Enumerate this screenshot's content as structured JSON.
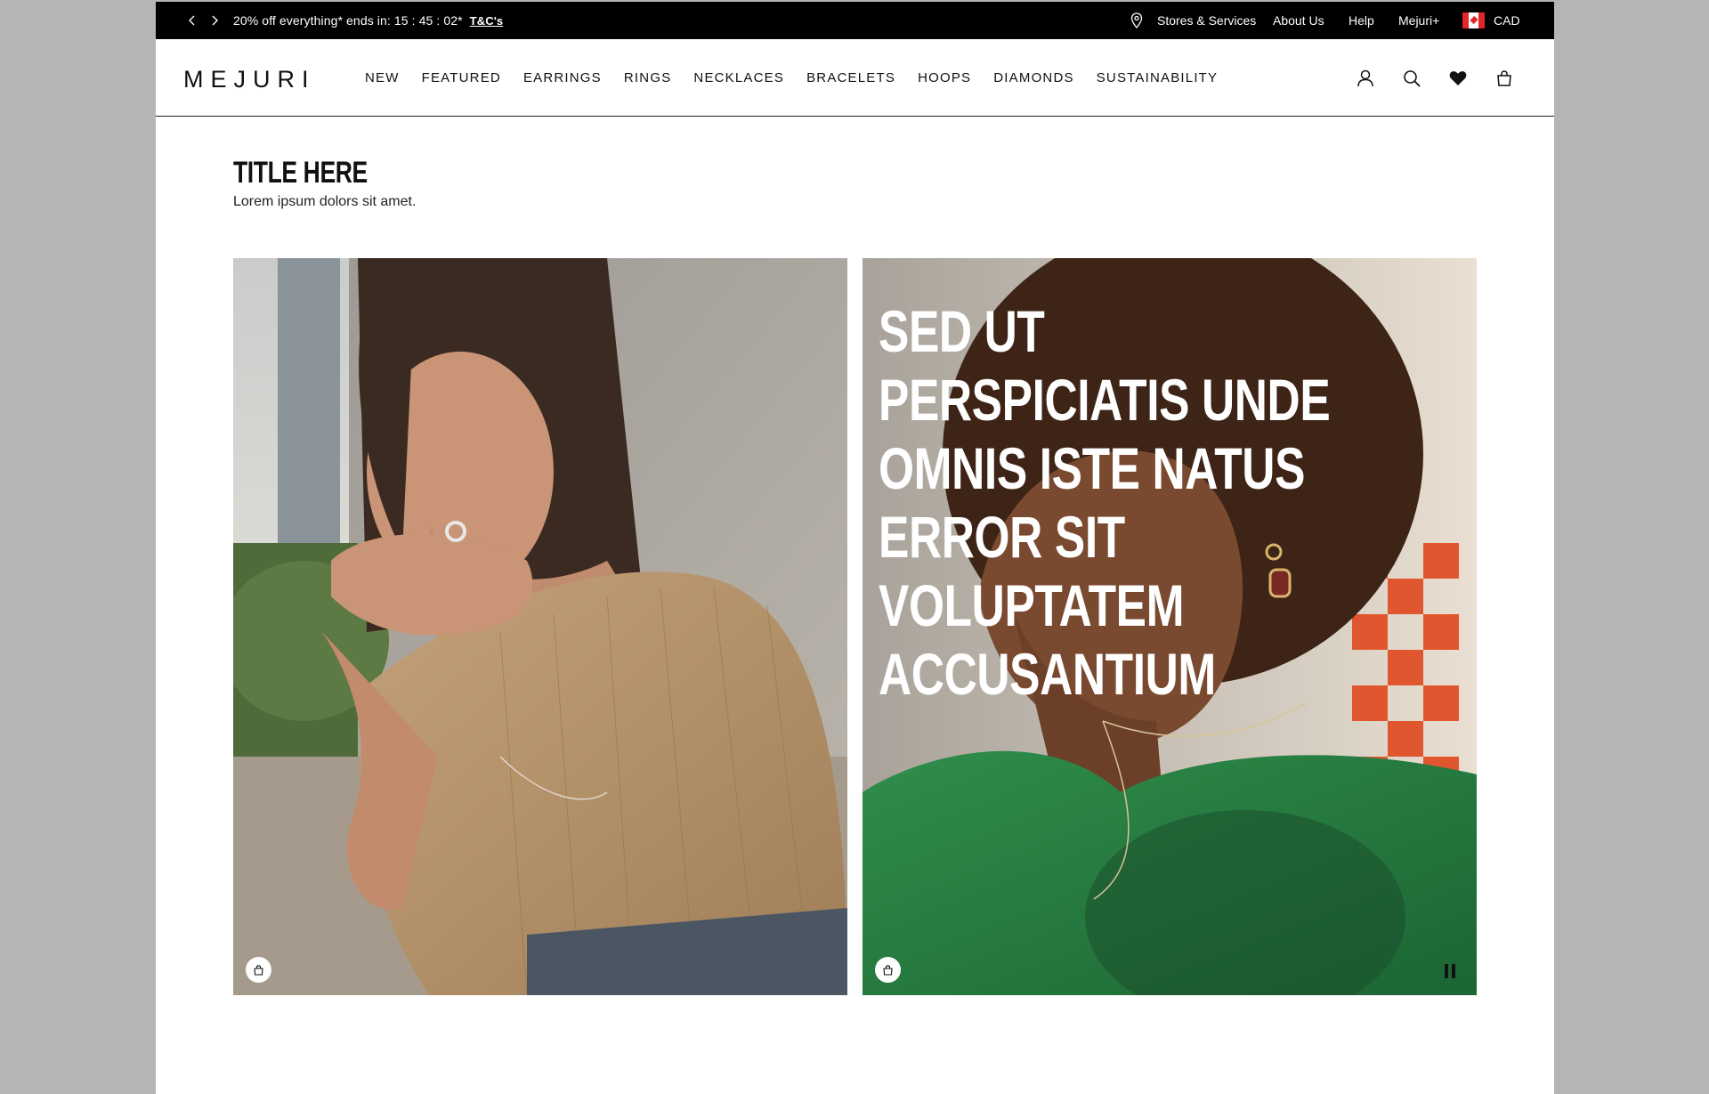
{
  "promo_bar": {
    "prev_icon": "chevron-left-icon",
    "next_icon": "chevron-right-icon",
    "message": "20% off everything* ends in: 15 : 45 : 02*",
    "terms_link": "T&C's",
    "stores_label": "Stores & Services",
    "stores_icon": "location-pin-icon",
    "about_label": "About Us",
    "help_label": "Help",
    "loyalty_label": "Mejuri+",
    "currency_label": "CAD",
    "currency_flag": "canada-flag-icon"
  },
  "header": {
    "logo": "MEJURI",
    "nav": [
      "NEW",
      "FEATURED",
      "EARRINGS",
      "RINGS",
      "NECKLACES",
      "BRACELETS",
      "HOOPS",
      "DIAMONDS",
      "SUSTAINABILITY"
    ],
    "icons": [
      "account-icon",
      "search-icon",
      "wishlist-heart-icon",
      "shopping-bag-icon"
    ]
  },
  "section": {
    "title": "TITLE HERE",
    "subtitle": "Lorem ipsum dolors sit amet."
  },
  "cards": {
    "right_headline": "SED UT PERSPICIATIS UNDE OMNIS ISTE NATUS ERROR SIT VOLUPTATEM ACCUSANTIUM"
  },
  "colors": {
    "top_bar_bg": "#000000",
    "page_bg": "#ffffff",
    "frame_bg": "#b5b5b5",
    "flag_red": "#e02626"
  }
}
